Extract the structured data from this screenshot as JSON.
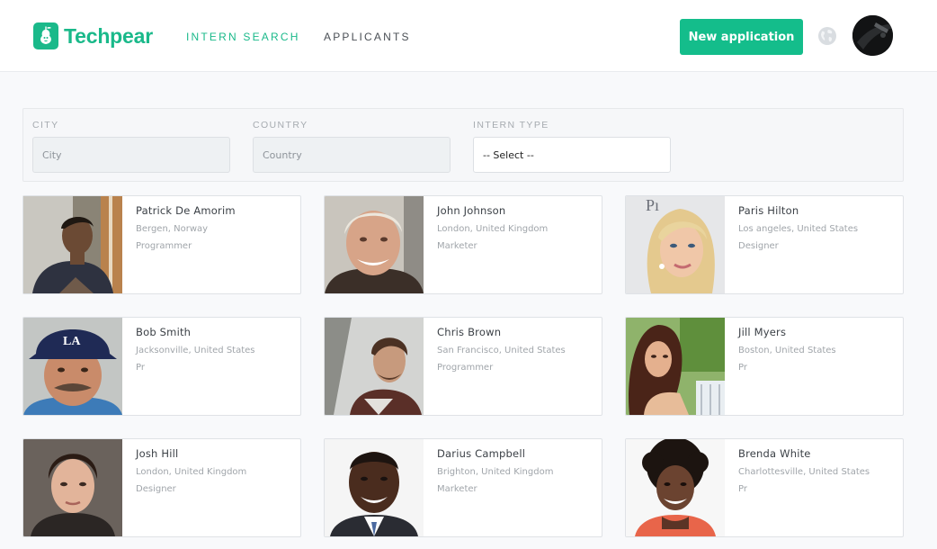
{
  "header": {
    "brand": "Techpear",
    "nav": [
      {
        "label": "INTERN SEARCH",
        "active": true
      },
      {
        "label": "APPLICANTS",
        "active": false
      }
    ],
    "cta_label": "New application",
    "icons": [
      "pear-logo-icon",
      "globe-icon",
      "user-avatar"
    ]
  },
  "filters": {
    "city": {
      "label": "CITY",
      "placeholder": "City"
    },
    "country": {
      "label": "COUNTRY",
      "placeholder": "Country"
    },
    "intern_type": {
      "label": "INTERN TYPE",
      "selected": "-- Select --"
    }
  },
  "interns": [
    {
      "name": "Patrick De Amorim",
      "location": "Bergen, Norway",
      "role": "Programmer"
    },
    {
      "name": "John Johnson",
      "location": "London, United Kingdom",
      "role": "Marketer"
    },
    {
      "name": "Paris Hilton",
      "location": "Los angeles, United States",
      "role": "Designer"
    },
    {
      "name": "Bob Smith",
      "location": "Jacksonville, United States",
      "role": "Pr"
    },
    {
      "name": "Chris Brown",
      "location": "San Francisco, United States",
      "role": "Programmer"
    },
    {
      "name": "Jill Myers",
      "location": "Boston, United States",
      "role": "Pr"
    },
    {
      "name": "Josh Hill",
      "location": "London, United Kingdom",
      "role": "Designer"
    },
    {
      "name": "Darius Campbell",
      "location": "Brighton, United Kingdom",
      "role": "Marketer"
    },
    {
      "name": "Brenda White",
      "location": "Charlottesville, United States",
      "role": "Pr"
    }
  ],
  "colors": {
    "accent": "#1ab98a",
    "background": "#f8f9fb"
  }
}
